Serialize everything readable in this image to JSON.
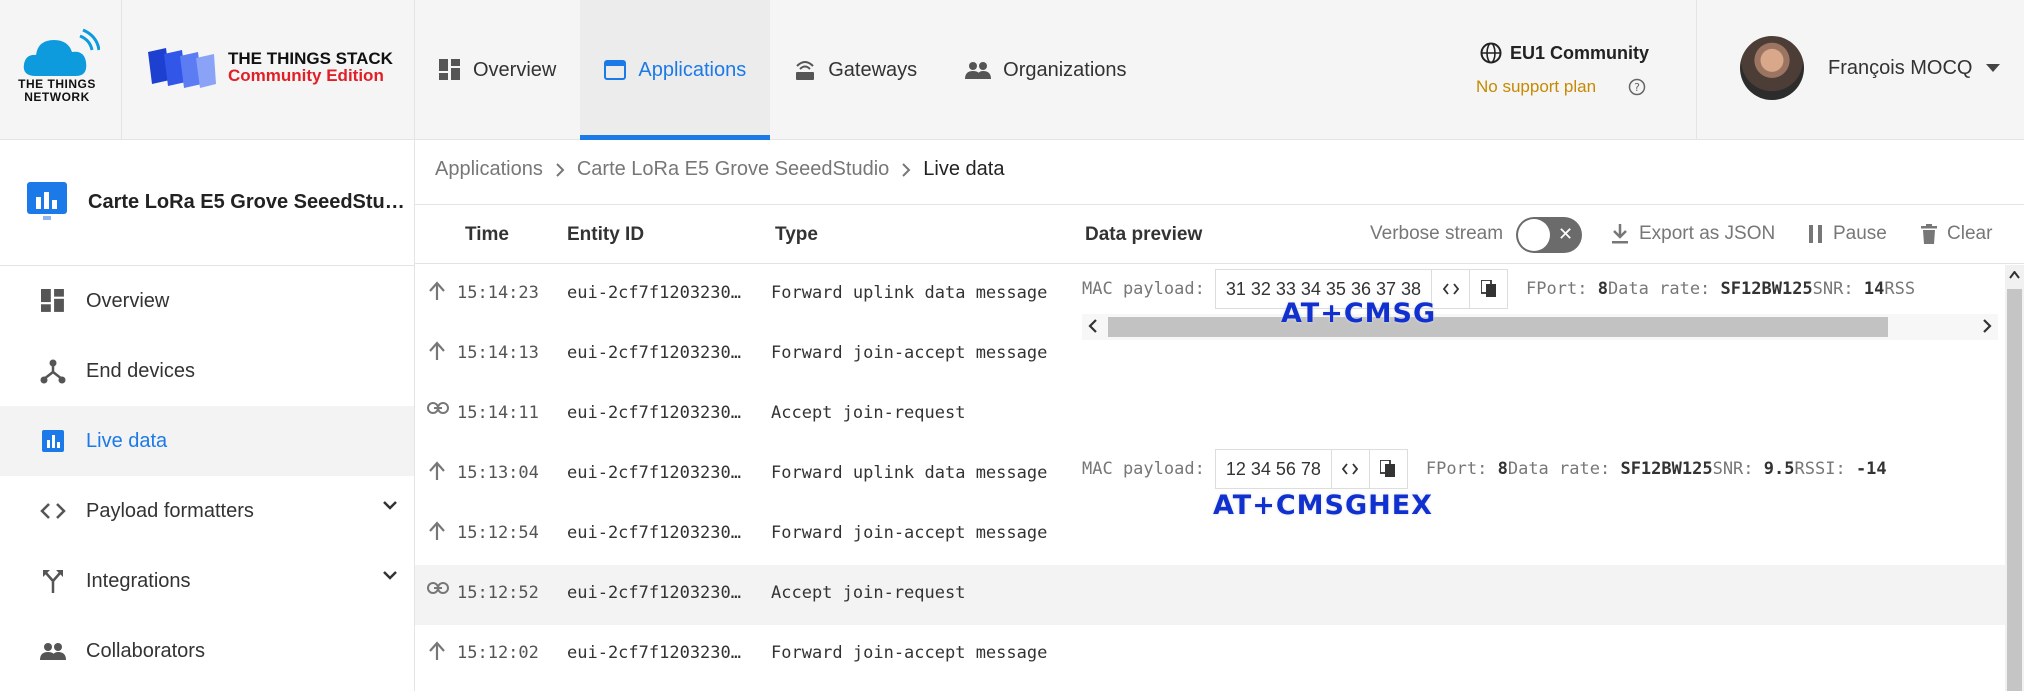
{
  "brand": {
    "ttn_name": "THE THINGS NETWORK",
    "stack_title": "THE THINGS STACK",
    "stack_subtitle": "Community Edition"
  },
  "nav": {
    "items": [
      {
        "label": "Overview",
        "icon": "dashboard-icon"
      },
      {
        "label": "Applications",
        "icon": "application-icon",
        "active": true
      },
      {
        "label": "Gateways",
        "icon": "gateway-icon"
      },
      {
        "label": "Organizations",
        "icon": "people-icon"
      }
    ]
  },
  "cluster": {
    "name": "EU1 Community",
    "support": "No support plan"
  },
  "user": {
    "name": "François MOCQ"
  },
  "sidebar": {
    "app_name": "Carte LoRa E5 Grove SeeedStu…",
    "items": [
      {
        "label": "Overview",
        "icon": "dashboard-icon"
      },
      {
        "label": "End devices",
        "icon": "devices-icon"
      },
      {
        "label": "Live data",
        "icon": "bar-chart-icon",
        "active": true
      },
      {
        "label": "Payload formatters",
        "icon": "code-icon",
        "expandable": true
      },
      {
        "label": "Integrations",
        "icon": "merge-icon",
        "expandable": true
      },
      {
        "label": "Collaborators",
        "icon": "people-icon"
      }
    ]
  },
  "breadcrumb": [
    "Applications",
    "Carte LoRa E5 Grove SeeedStudio",
    "Live data"
  ],
  "table": {
    "headers": {
      "time": "Time",
      "entity": "Entity ID",
      "type": "Type",
      "preview": "Data preview"
    },
    "verbose_label": "Verbose stream",
    "verbose_on": false,
    "export_label": "Export as JSON",
    "pause_label": "Pause",
    "clear_label": "Clear",
    "rows": [
      {
        "icon": "arrow-up-icon",
        "time": "15:14:23",
        "entity": "eui-2cf7f1203230…",
        "type": "Forward uplink data message"
      },
      {
        "icon": "arrow-up-icon",
        "time": "15:14:13",
        "entity": "eui-2cf7f1203230…",
        "type": "Forward join-accept message"
      },
      {
        "icon": "link-icon",
        "time": "15:14:11",
        "entity": "eui-2cf7f1203230…",
        "type": "Accept join-request"
      },
      {
        "icon": "arrow-up-icon",
        "time": "15:13:04",
        "entity": "eui-2cf7f1203230…",
        "type": "Forward uplink data message"
      },
      {
        "icon": "arrow-up-icon",
        "time": "15:12:54",
        "entity": "eui-2cf7f1203230…",
        "type": "Forward join-accept message"
      },
      {
        "icon": "link-icon",
        "time": "15:12:52",
        "entity": "eui-2cf7f1203230…",
        "type": "Accept join-request"
      },
      {
        "icon": "arrow-up-icon",
        "time": "15:12:02",
        "entity": "eui-2cf7f1203230…",
        "type": "Forward join-accept message"
      }
    ],
    "preview1": {
      "label": "MAC payload:",
      "payload": "31 32 33 34 35 36 37 38",
      "fport_label": "FPort:",
      "fport": "8",
      "rate_label": "Data rate:",
      "rate": "SF12BW125",
      "snr_label": "SNR:",
      "snr": "14",
      "rssi_label": "RSS"
    },
    "preview2": {
      "label": "MAC payload:",
      "payload": "12 34 56 78",
      "fport_label": "FPort:",
      "fport": "8",
      "rate_label": "Data rate:",
      "rate": "SF12BW125",
      "snr_label": "SNR:",
      "snr": "9.5",
      "rssi_label": "RSSI:",
      "rssi": "-14"
    }
  },
  "annotations": {
    "first": "AT+CMSG",
    "second": "AT+CMSGHEX"
  },
  "colors": {
    "accent": "#1b7ae8",
    "brand_red": "#e01f26",
    "support": "#c68a00",
    "annotation": "#1030d0"
  }
}
